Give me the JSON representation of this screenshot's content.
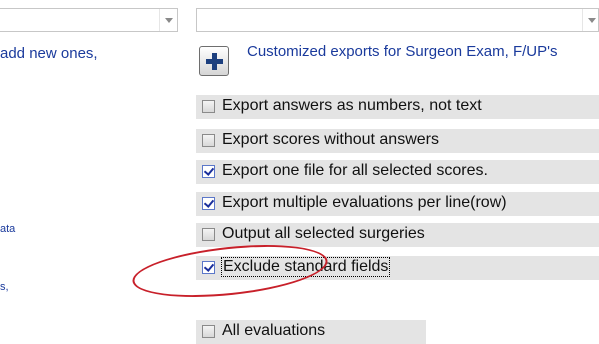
{
  "left_panel": {
    "line1": "add new ones,",
    "line2": "ata",
    "line3": "s,"
  },
  "dropdowns": [
    {
      "value": ""
    },
    {
      "value": ""
    }
  ],
  "customized": {
    "label": "Customized exports for Surgeon Exam, F/UP's",
    "icon": "plus-icon"
  },
  "options": [
    {
      "label": "Export answers as numbers, not text",
      "checked": false
    },
    {
      "label": "Export scores without answers",
      "checked": false
    },
    {
      "label": "Export one file for all selected scores.",
      "checked": true
    },
    {
      "label": "Export multiple evaluations per line(row)",
      "checked": true
    },
    {
      "label": "Output all selected surgeries",
      "checked": false
    },
    {
      "label": "Exclude standard fields",
      "checked": true
    }
  ],
  "all_evaluations": {
    "label": "All evaluations",
    "checked": false
  },
  "colors": {
    "link_blue": "#1a3a9c",
    "row_gray": "#e4e4e4",
    "highlight_red": "#c8202a"
  }
}
